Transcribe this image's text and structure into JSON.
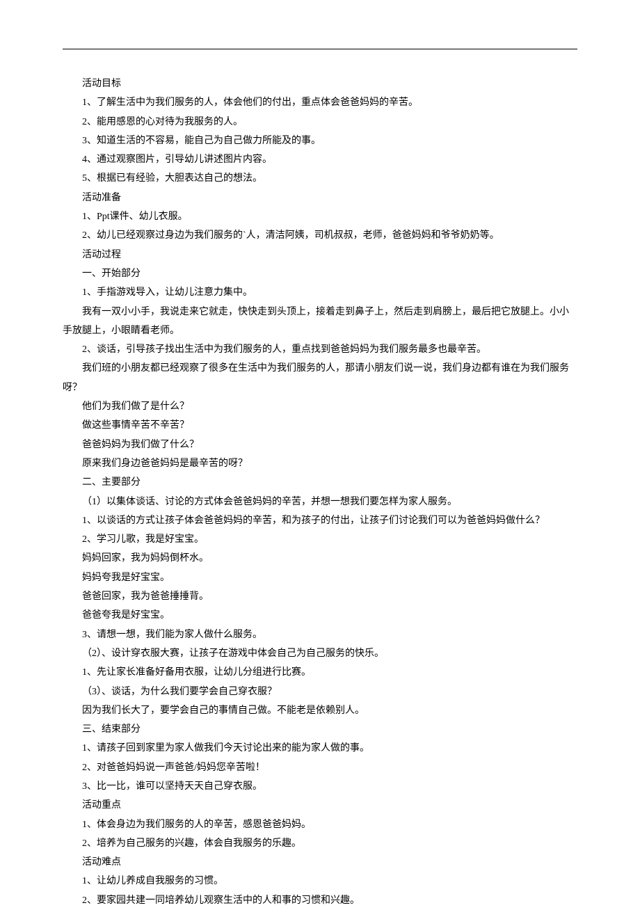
{
  "lines": [
    "活动目标",
    "1、了解生活中为我们服务的人，体会他们的付出，重点体会爸爸妈妈的辛苦。",
    "2、能用感恩的心对待为我服务的人。",
    "3、知道生活的不容易，能自己为自己做力所能及的事。",
    "4、通过观察图片，引导幼儿讲述图片内容。",
    "5、根据已有经验，大胆表达自己的想法。",
    "活动准备",
    "1、Ppt课件、幼儿衣服。",
    "2、幼儿已经观察过身边为我们服务的`人，清洁阿姨，司机叔叔，老师，爸爸妈妈和爷爷奶奶等。",
    "活动过程",
    "一、开始部分",
    "1、手指游戏导入，让幼儿注意力集中。",
    "我有一双小小手，我说走来它就走，快快走到头顶上，接着走到鼻子上，然后走到肩膀上，最后把它放腿上。小小手放腿上，小眼睛看老师。",
    "2、谈话，引导孩子找出生活中为我们服务的人，重点找到爸爸妈妈为我们服务最多也最辛苦。",
    "我们班的小朋友都已经观察了很多在生活中为我们服务的人，那请小朋友们说一说，我们身边都有谁在为我们服务呀？",
    "他们为我们做了是什么？",
    "做这些事情辛苦不辛苦？",
    "爸爸妈妈为我们做了什么？",
    "原来我们身边爸爸妈妈是最辛苦的呀？",
    "二、主要部分",
    "（1）以集体谈话、讨论的方式体会爸爸妈妈的辛苦，并想一想我们要怎样为家人服务。",
    "1、以谈话的方式让孩子体会爸爸妈妈的辛苦，和为孩子的付出，让孩子们讨论我们可以为爸爸妈妈做什么？",
    "2、学习儿歌，我是好宝宝。",
    "妈妈回家，我为妈妈倒杯水。",
    "妈妈夸我是好宝宝。",
    "爸爸回家，我为爸爸捶捶背。",
    "爸爸夸我是好宝宝。",
    "3、请想一想，我们能为家人做什么服务。",
    "（2）、设计穿衣服大赛，让孩子在游戏中体会自己为自己服务的快乐。",
    "1、先让家长准备好备用衣服，让幼儿分组进行比赛。",
    "（3）、谈话，为什么我们要学会自己穿衣服？",
    "因为我们长大了，要学会自己的事情自己做。不能老是依赖别人。",
    "三、结束部分",
    "1、请孩子回到家里为家人做我们今天讨论出来的能为家人做的事。",
    "2、对爸爸妈妈说一声爸爸/妈妈您辛苦啦！",
    "3、比一比，谁可以坚持天天自己穿衣服。",
    "活动重点",
    "1、体会身边为我们服务的人的辛苦，感恩爸爸妈妈。",
    "2、培养为自己服务的兴趣，体会自我服务的乐趣。",
    "活动难点",
    "1、让幼儿养成自我服务的习惯。",
    "2、要家园共建一同培养幼儿观察生活中的人和事的习惯和兴趣。"
  ],
  "wrap_continuations": {
    "12": 1,
    "14": 1
  }
}
